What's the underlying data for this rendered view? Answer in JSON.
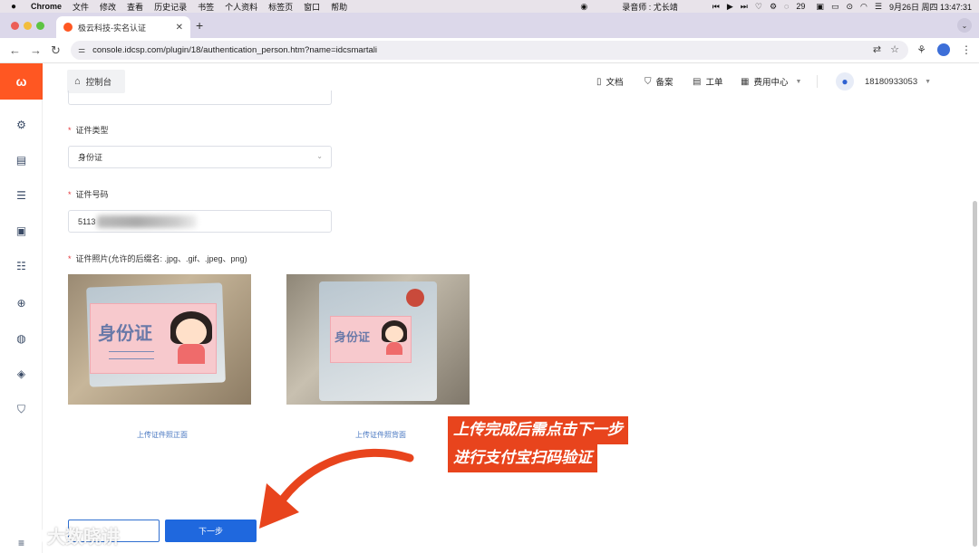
{
  "menubar": {
    "app": "Chrome",
    "items": [
      "文件",
      "修改",
      "查看",
      "历史记录",
      "书签",
      "个人资料",
      "标签页",
      "窗口",
      "帮助"
    ],
    "recorder": "录音师 : 尤长靖",
    "msg_count": "29",
    "datetime": "9月26日 周四  13:47:31"
  },
  "browser": {
    "tab_title": "极云科技-实名认证",
    "url": "console.idcsp.com/plugin/18/authentication_person.htm?name=idcsmartali"
  },
  "topbar": {
    "console_label": "控制台",
    "docs_label": "文档",
    "filing_label": "备案",
    "ticket_label": "工单",
    "billing_label": "费用中心",
    "username": "18180933053"
  },
  "form": {
    "id_type_label": "证件类型",
    "id_type_value": "身份证",
    "id_number_label": "证件号码",
    "id_number_value": "5113",
    "photo_label": "证件照片(允许的后缀名: .jpg、.gif、.jpeg、png)",
    "front_label": "上传证件照正面",
    "back_label": "上传证件照背面",
    "sticker_text": "身份证",
    "next_button": "下一步"
  },
  "annotation": {
    "line1": "上传完成后需点击下一步",
    "line2": "进行支付宝扫码验证"
  },
  "watermark": {
    "text": "大数晓讲"
  },
  "colors": {
    "brand": "#ff5722",
    "primary": "#1f68de",
    "annotation": "#e8441d"
  }
}
